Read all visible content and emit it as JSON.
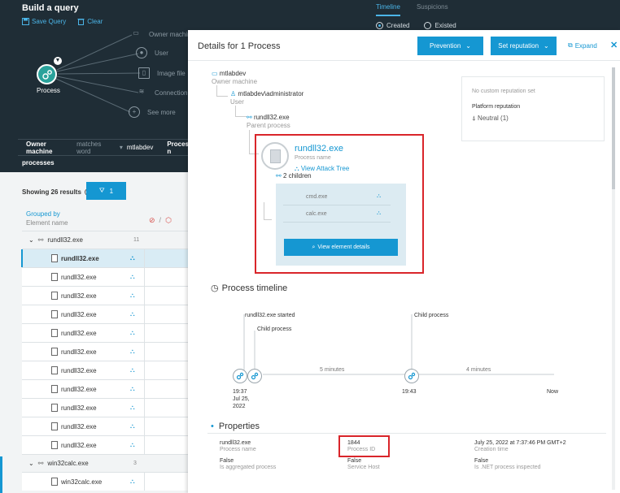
{
  "query_builder": {
    "title": "Build a query",
    "save_query": "Save Query",
    "clear": "Clear",
    "tabs": [
      "Timeline",
      "Suspicions"
    ],
    "radios": [
      "Created",
      "Existed"
    ],
    "node_label": "Process",
    "options": [
      "Owner machine",
      "User",
      "Image file",
      "Connection",
      "See more"
    ],
    "filter": {
      "field1": "Owner machine",
      "op1": "matches word",
      "value1": "mtlabdev",
      "field2": "Process n",
      "second_line": "processes"
    }
  },
  "results": {
    "showing": "Showing 26 results",
    "filter_count": "1",
    "grouped_by": "Grouped by",
    "element_name": "Element name",
    "groups": [
      {
        "name": "rundll32.exe",
        "count": "11",
        "items": [
          "rundll32.exe",
          "rundll32.exe",
          "rundll32.exe",
          "rundll32.exe",
          "rundll32.exe",
          "rundll32.exe",
          "rundll32.exe",
          "rundll32.exe",
          "rundll32.exe",
          "rundll32.exe",
          "rundll32.exe"
        ]
      },
      {
        "name": "win32calc.exe",
        "count": "3",
        "items": [
          "win32calc.exe"
        ]
      }
    ]
  },
  "details": {
    "title": "Details for 1 Process",
    "prevention": "Prevention",
    "set_reputation": "Set reputation",
    "expand": "Expand",
    "owner_machine": "mtlabdev",
    "owner_machine_label": "Owner machine",
    "user": "mtlabdev\\administrator",
    "user_label": "User",
    "parent": "rundll32.exe",
    "parent_label": "Parent process",
    "process_name": "rundll32.exe",
    "process_name_label": "Process name",
    "view_attack_tree": "View Attack Tree",
    "children_label": "2 children",
    "children": [
      "cmd.exe",
      "calc.exe"
    ],
    "view_element_details": "View element details",
    "reputation": {
      "none": "No custom reputation set",
      "platform_label": "Platform reputation",
      "platform_value": "Neutral (1)"
    },
    "timeline": {
      "title": "Process timeline",
      "events": [
        "rundll32.exe started",
        "Child process",
        "Child process"
      ],
      "durations": [
        "5 minutes",
        "4 minutes"
      ],
      "start_time": "19:37",
      "start_date": "Jul 25,",
      "start_year": "2022",
      "mid_time": "19:43",
      "end": "Now"
    },
    "properties": {
      "title": "Properties",
      "items": [
        {
          "value": "rundll32.exe",
          "key": "Process name"
        },
        {
          "value": "1844",
          "key": "Process ID"
        },
        {
          "value": "July 25, 2022 at 7:37:46 PM GMT+2",
          "key": "Creation time"
        },
        {
          "value": "False",
          "key": "Is aggregated process"
        },
        {
          "value": "False",
          "key": "Service Host"
        },
        {
          "value": "False",
          "key": "Is .NET process inspected"
        }
      ]
    }
  },
  "colors": {
    "accent": "#1597d2",
    "dark_bg": "#1f2d36",
    "highlight": "#d9252a"
  }
}
